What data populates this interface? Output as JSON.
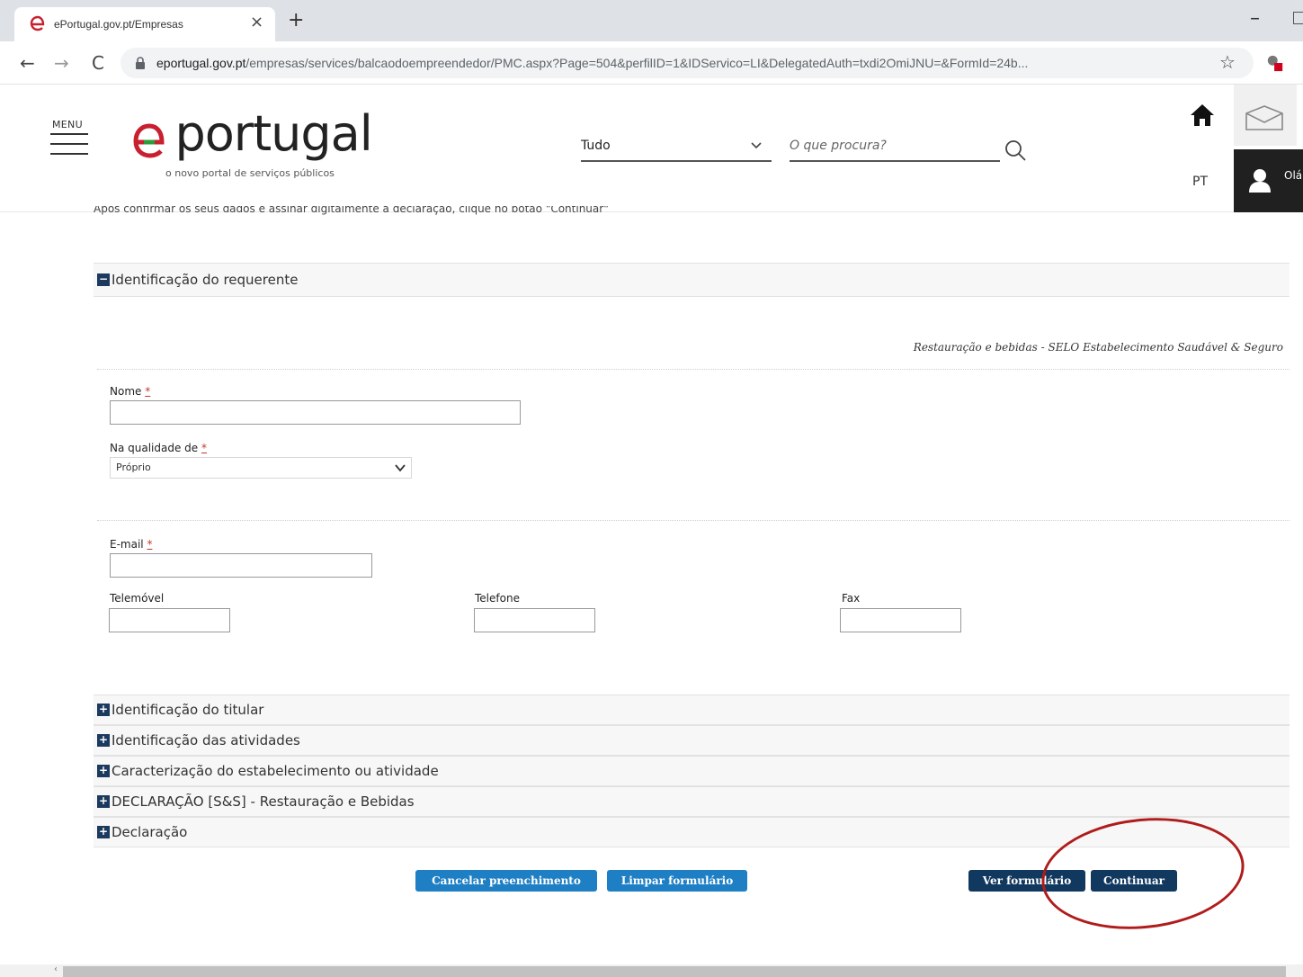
{
  "browser": {
    "tab_title": "ePortugal.gov.pt/Empresas",
    "url_domain": "eportugal.gov.pt",
    "url_path": "/empresas/services/balcaodoempreendedor/PMC.aspx?Page=504&perfilID=1&IDServico=LI&DelegatedAuth=txdi2OmiJNU=&FormId=24b..."
  },
  "header": {
    "menu_label": "MENU",
    "logo_text": "eportugal",
    "logo_subtitle": "o novo portal de serviços públicos",
    "category_value": "Tudo",
    "search_placeholder": "O que procura?",
    "language": "PT",
    "user_greeting": "Olá"
  },
  "page": {
    "instructions": "Após confirmar os seus dados e assinar digitalmente a declaração, clique no botão \"Continuar\"",
    "service_label": "Restauração e bebidas - SELO Estabelecimento Saudável & Seguro",
    "open_section": {
      "toggle": "−",
      "label": "Identificação do requerente"
    },
    "fields": {
      "nome_label": "Nome",
      "qualidade_label": "Na qualidade de",
      "qualidade_value": "Próprio",
      "email_label": "E-mail",
      "telemovel_label": "Telemóvel",
      "telefone_label": "Telefone",
      "fax_label": "Fax",
      "required_mark": "*"
    },
    "collapsed_sections": [
      {
        "toggle": "+",
        "label": "Identificação do titular"
      },
      {
        "toggle": "+",
        "label": "Identificação das atividades"
      },
      {
        "toggle": "+",
        "label": "Caracterização do estabelecimento ou atividade"
      },
      {
        "toggle": "+",
        "label": "DECLARAÇÃO [S&S] - Restauração e Bebidas"
      },
      {
        "toggle": "+",
        "label": "Declaração"
      }
    ],
    "buttons": {
      "cancel": "Cancelar preenchimento",
      "clear": "Limpar formulário",
      "view": "Ver formulário",
      "continue": "Continuar"
    }
  },
  "colors": {
    "button_light": "#1e7fc4",
    "button_dark": "#11385e",
    "toggle": "#1c3a5e",
    "annotation": "#b01c1c",
    "required": "#c0392b"
  }
}
